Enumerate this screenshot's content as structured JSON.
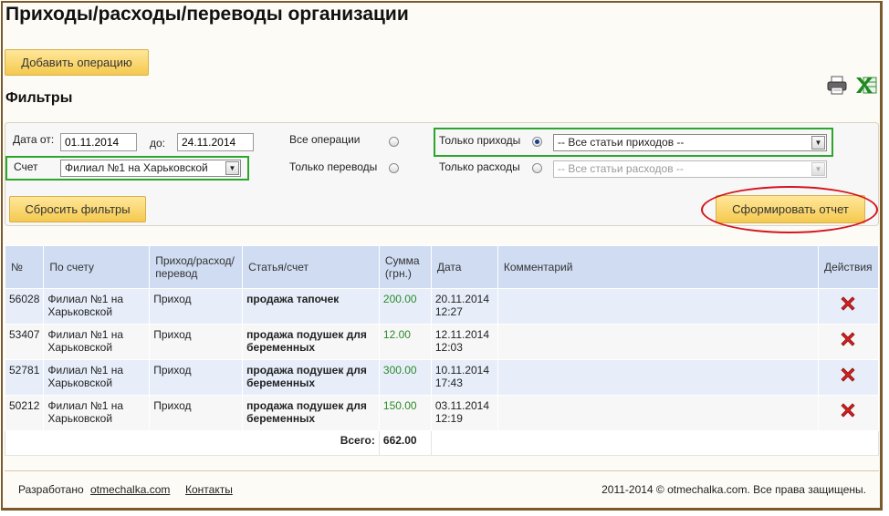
{
  "page": {
    "title": "Приходы/расходы/переводы организации",
    "add_button": "Добавить операцию",
    "filters_heading": "Фильтры"
  },
  "export": {
    "print_icon": "printer-icon",
    "excel_icon": "excel-icon"
  },
  "filters": {
    "date_from_label": "Дата от:",
    "date_from_value": "01.11.2014",
    "date_to_label": "до:",
    "date_to_value": "24.11.2014",
    "account_label": "Счет",
    "account_value": "Филиал №1 на Харьковской",
    "all_ops_label": "Все операции",
    "transfers_label": "Только переводы",
    "income_label": "Только приходы",
    "income_select": "-- Все статьи приходов --",
    "expense_label": "Только расходы",
    "expense_select": "-- Все статьи расходов --",
    "selected_radio": "Только приходы",
    "reset_button": "Сбросить фильтры",
    "report_button": "Сформировать отчет"
  },
  "table": {
    "headers": [
      "№",
      "По счету",
      "Приход/расход/перевод",
      "Статья/счет",
      "Сумма (грн.)",
      "Дата",
      "Комментарий",
      "Действия"
    ],
    "rows": [
      {
        "id": "56028",
        "account": "Филиал №1 на Харьковской",
        "type": "Приход",
        "article": "продажа тапочек",
        "sum": "200.00",
        "date": "20.11.2014",
        "time": "12:27",
        "comment": ""
      },
      {
        "id": "53407",
        "account": "Филиал №1 на Харьковской",
        "type": "Приход",
        "article": "продажа подушек для беременных",
        "sum": "12.00",
        "date": "12.11.2014",
        "time": "12:03",
        "comment": ""
      },
      {
        "id": "52781",
        "account": "Филиал №1 на Харьковской",
        "type": "Приход",
        "article": "продажа подушек для беременных",
        "sum": "300.00",
        "date": "10.11.2014",
        "time": "17:43",
        "comment": ""
      },
      {
        "id": "50212",
        "account": "Филиал №1 на Харьковской",
        "type": "Приход",
        "article": "продажа подушек для беременных",
        "sum": "150.00",
        "date": "03.11.2014",
        "time": "12:19",
        "comment": ""
      }
    ],
    "total_label": "Всего:",
    "total_value": "662.00",
    "delete_icon": "delete-icon"
  },
  "colors": {
    "accent_button": "#f5c94f",
    "header_bg": "#cfdcf2",
    "sum_green": "#2b8a2b",
    "highlight_green": "#2da52d",
    "highlight_red": "#d4161e"
  },
  "footer": {
    "developed_by": "Разработано",
    "developer_link": "otmechalka.com",
    "contacts_link": "Контакты",
    "copyright": "2011-2014 © otmechalka.com. Все права защищены."
  }
}
